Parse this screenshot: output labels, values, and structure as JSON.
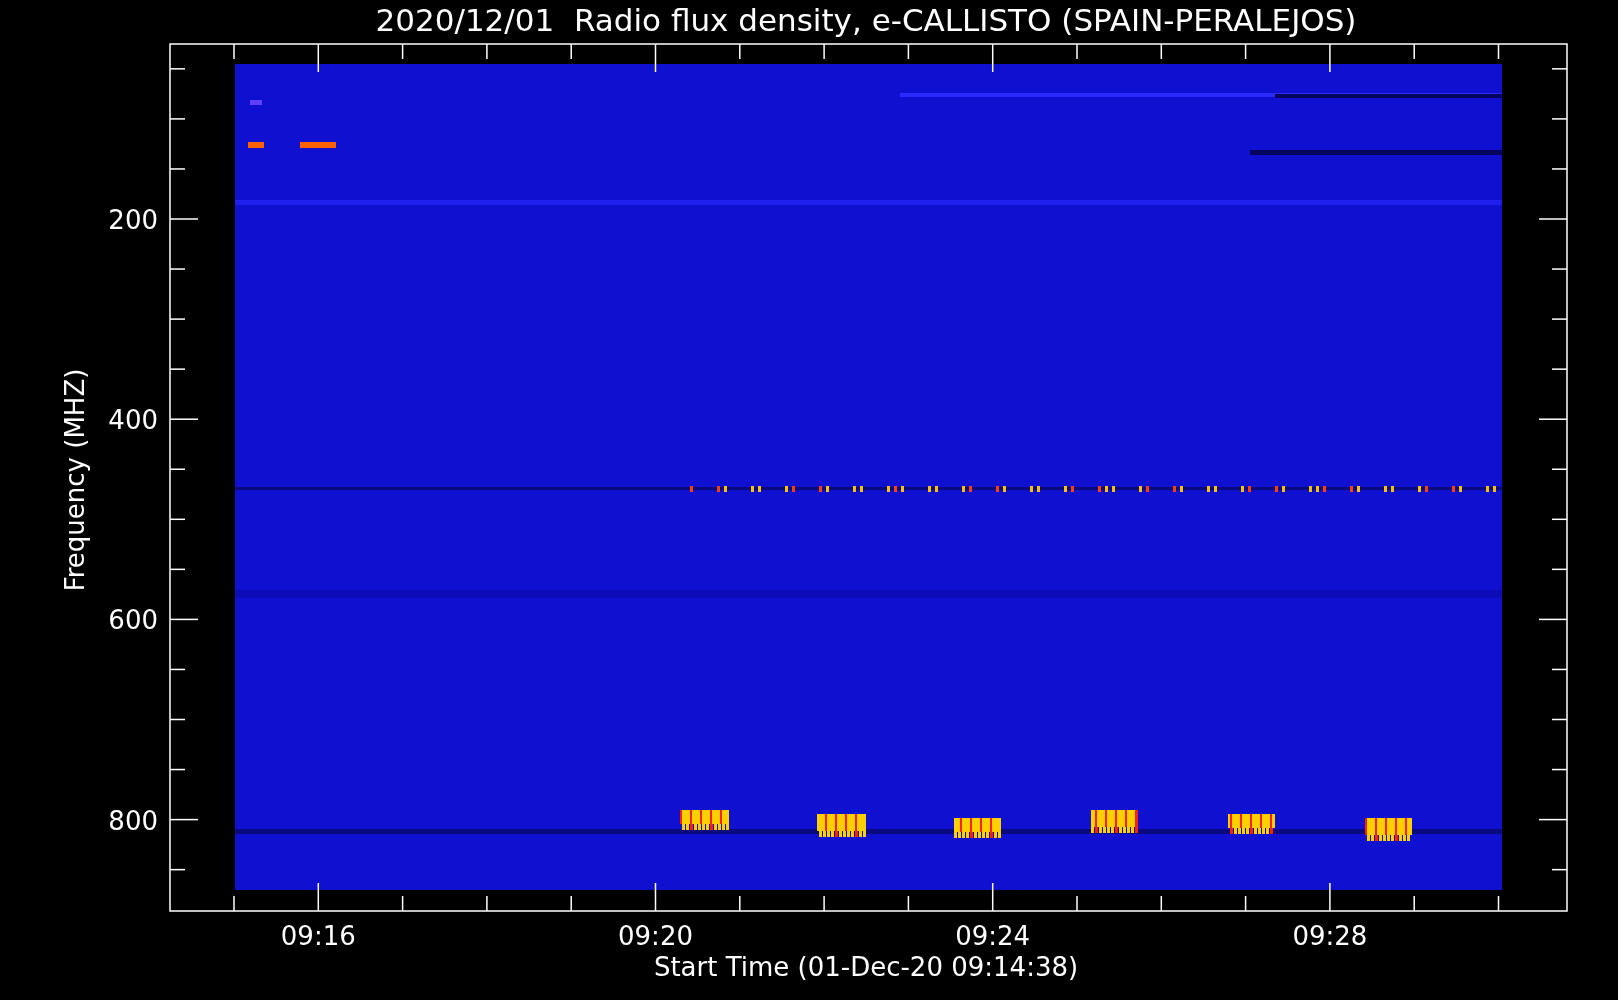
{
  "title": "2020/12/01  Radio flux density, e-CALLISTO (SPAIN-PERALEJOS)",
  "plot": {
    "ylabel": "Frequency (MHZ)",
    "yticks": [
      "200",
      "400",
      "600",
      "800"
    ],
    "xticks": [
      "09:16",
      "09:20",
      "09:24",
      "09:28"
    ],
    "xlabel": "Start Time (01-Dec-20 09:14:38)"
  }
}
